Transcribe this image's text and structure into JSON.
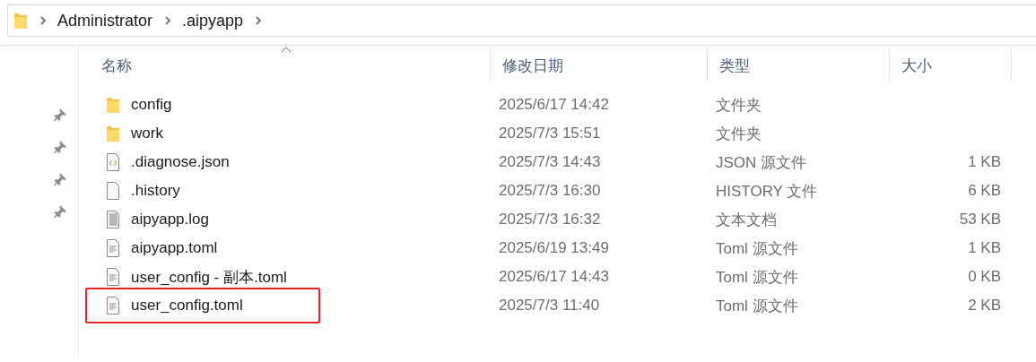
{
  "address_bar": {
    "path": [
      {
        "label": "Administrator"
      },
      {
        "label": ".aipyapp"
      }
    ]
  },
  "columns": [
    {
      "label": "名称",
      "sorted": true
    },
    {
      "label": "修改日期",
      "sorted": false
    },
    {
      "label": "类型",
      "sorted": false
    },
    {
      "label": "大小",
      "sorted": false
    }
  ],
  "rows": [
    {
      "kind": "folder",
      "name": "config",
      "modified": "2025/6/17 14:42",
      "type": "文件夹",
      "highlighted": false
    },
    {
      "kind": "folder",
      "name": "work",
      "modified": "2025/7/3 15:51",
      "type": "文件夹",
      "highlighted": false
    },
    {
      "kind": "json",
      "name": ".diagnose.json",
      "modified": "2025/7/3 14:43",
      "type": "JSON 源文件",
      "size": "1 KB",
      "highlighted": false
    },
    {
      "kind": "blank",
      "name": ".history",
      "modified": "2025/7/3 16:30",
      "type": "HISTORY 文件",
      "size": "6 KB",
      "highlighted": false
    },
    {
      "kind": "text",
      "name": "aipyapp.log",
      "modified": "2025/7/3 16:32",
      "type": "文本文档",
      "size": "53 KB",
      "highlighted": false
    },
    {
      "kind": "toml",
      "name": "aipyapp.toml",
      "modified": "2025/6/19 13:49",
      "type": "Toml 源文件",
      "size": "1 KB",
      "highlighted": false
    },
    {
      "kind": "toml",
      "name": "user_config - 副本.toml",
      "modified": "2025/6/17 14:43",
      "type": "Toml 源文件",
      "size": "0 KB",
      "highlighted": false
    },
    {
      "kind": "toml",
      "name": "user_config.toml",
      "modified": "2025/7/3 11:40",
      "type": "Toml 源文件",
      "size": "2 KB",
      "highlighted": true
    }
  ]
}
